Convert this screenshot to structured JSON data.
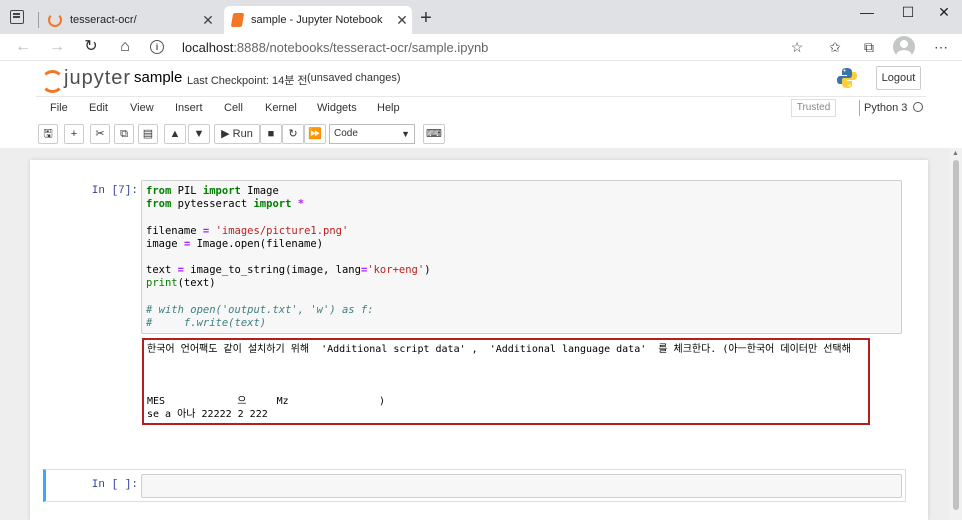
{
  "browser": {
    "tabs": [
      {
        "title": "tesseract-ocr/",
        "icon": "jupyter-ring-icon"
      },
      {
        "title": "sample - Jupyter Notebook",
        "icon": "jupyter-notebook-icon"
      }
    ],
    "close_glyph": "✕",
    "new_tab_glyph": "+",
    "window_controls": {
      "minimize": "—",
      "maximize": "☐",
      "close": "✕"
    },
    "url_host": "localhost",
    "url_path": ":8888/notebooks/tesseract-ocr/sample.ipynb"
  },
  "jupyter": {
    "logo_text": "jupyter",
    "notebook_name": "sample",
    "checkpoint": "Last Checkpoint: 14분 전",
    "unsaved": "(unsaved changes)",
    "logout_label": "Logout",
    "menu": [
      "File",
      "Edit",
      "View",
      "Insert",
      "Cell",
      "Kernel",
      "Widgets",
      "Help"
    ],
    "trusted_label": "Trusted",
    "kernel_name": "Python 3",
    "run_label": "Run",
    "cell_type": "Code",
    "accent_color": "#f37726"
  },
  "cells": {
    "cell1_prompt": "In [7]:",
    "code": [
      [
        {
          "t": "from",
          "c": "kw"
        },
        {
          "t": " PIL "
        },
        {
          "t": "import",
          "c": "kw"
        },
        {
          "t": " Image"
        }
      ],
      [
        {
          "t": "from",
          "c": "kw"
        },
        {
          "t": " pytesseract "
        },
        {
          "t": "import",
          "c": "kw"
        },
        {
          "t": " "
        },
        {
          "t": "*",
          "c": "op"
        }
      ],
      [],
      [
        {
          "t": "filename "
        },
        {
          "t": "=",
          "c": "op"
        },
        {
          "t": " "
        },
        {
          "t": "'images/picture1.png'",
          "c": "str"
        }
      ],
      [
        {
          "t": "image "
        },
        {
          "t": "=",
          "c": "op"
        },
        {
          "t": " Image.open(filename)"
        }
      ],
      [],
      [
        {
          "t": "text "
        },
        {
          "t": "=",
          "c": "op"
        },
        {
          "t": " image_to_string(image, lang"
        },
        {
          "t": "=",
          "c": "op"
        },
        {
          "t": "'kor+eng'",
          "c": "str"
        },
        {
          "t": ")"
        }
      ],
      [
        {
          "t": "print",
          "c": "bi"
        },
        {
          "t": "(text)"
        }
      ],
      [],
      [
        {
          "t": "# with open('output.txt', 'w') as f:",
          "c": "cm"
        }
      ],
      [
        {
          "t": "#     f.write(text)",
          "c": "cm"
        }
      ]
    ],
    "output": [
      "한국어 언어팩도 같이 설치하기 위해  'Additional script data' ,  'Additional language data'  를 체크한다. (아ㅡ한국어 데이터만 선택해",
      "",
      "",
      "",
      "MES            으     Mz               )",
      "se a 아나 22222 2 222"
    ],
    "cell2_prompt": "In [ ]:"
  }
}
